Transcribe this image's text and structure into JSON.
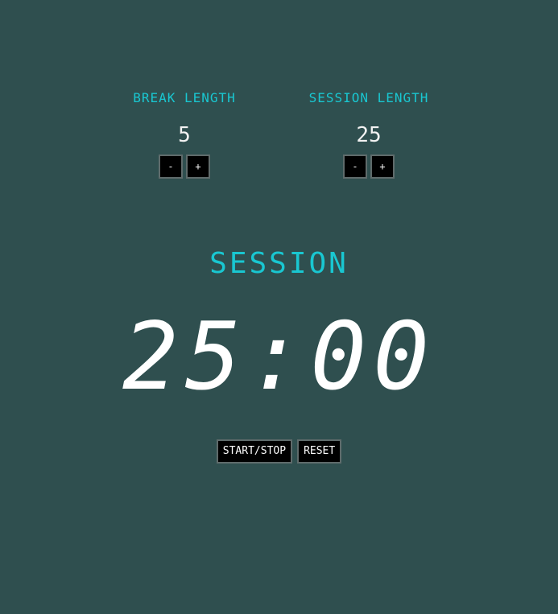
{
  "break": {
    "label": "Break Length",
    "value": "5",
    "decrement_label": "-",
    "increment_label": "+"
  },
  "session": {
    "label": "Session Length",
    "value": "25",
    "decrement_label": "-",
    "increment_label": "+"
  },
  "timer": {
    "label": "Session",
    "time_left": "25:00"
  },
  "controls": {
    "start_stop_label": "START/STOP",
    "reset_label": "RESET"
  },
  "colors": {
    "background": "#2f4f4f",
    "accent": "#19c7d1",
    "text": "#ffffff",
    "button_bg": "#000000"
  }
}
